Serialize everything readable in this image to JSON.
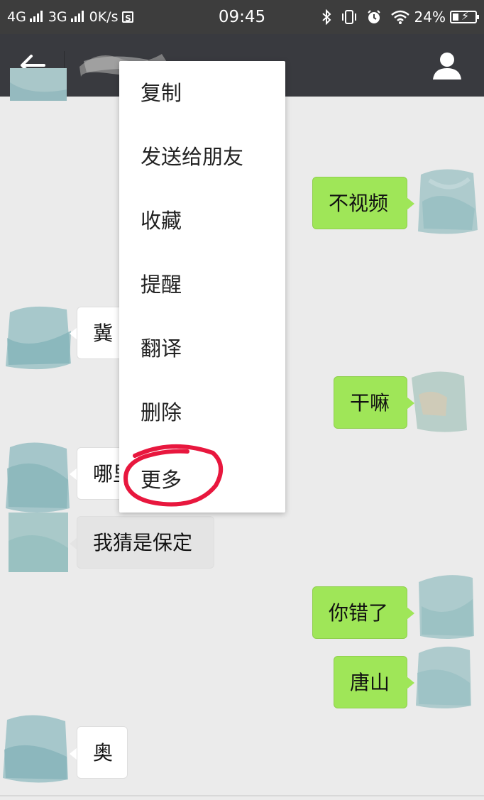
{
  "status_bar": {
    "network1": "4G",
    "network2": "3G",
    "speed": "0K/s",
    "s_badge": "S",
    "time": "09:45",
    "battery": "24%",
    "icons": [
      "bluetooth-icon",
      "vibrate-icon",
      "alarm-icon",
      "wifi-icon",
      "battery-charging-icon"
    ]
  },
  "nav": {
    "back_icon": "arrow-left-icon",
    "profile_icon": "person-icon"
  },
  "messages": [
    {
      "side": "mine",
      "text": "不视频"
    },
    {
      "side": "theirs",
      "text": "冀"
    },
    {
      "side": "mine",
      "text": "干嘛"
    },
    {
      "side": "theirs",
      "text": "哪里"
    },
    {
      "side": "theirs",
      "text": "我猜是保定"
    },
    {
      "side": "mine",
      "text": "你错了"
    },
    {
      "side": "mine",
      "text": "唐山"
    },
    {
      "side": "theirs",
      "text": "奥"
    }
  ],
  "context_menu": {
    "items": [
      "复制",
      "发送给朋友",
      "收藏",
      "提醒",
      "翻译",
      "删除",
      "更多"
    ],
    "highlighted": "更多"
  },
  "colors": {
    "status_bg": "#3d3d3d",
    "nav_bg": "#393a3f",
    "chat_bg": "#ebebeb",
    "my_bubble": "#9fe658",
    "annotation": "#e8173e"
  }
}
